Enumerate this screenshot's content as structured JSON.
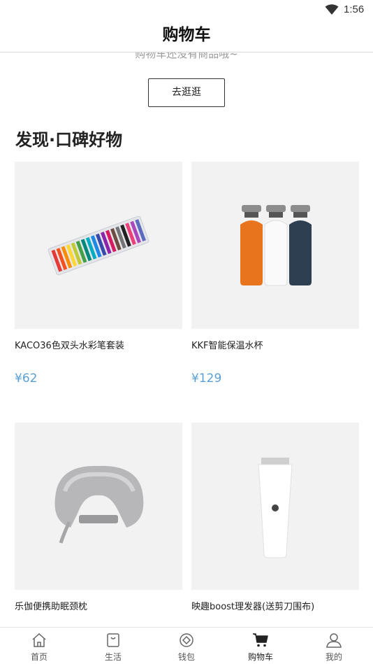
{
  "status_bar": {
    "time": "1:56"
  },
  "header": {
    "title": "购物车"
  },
  "empty_state": {
    "message": "购物车还没有商品哦~",
    "button_label": "去逛逛"
  },
  "section": {
    "title": "发现·口碑好物"
  },
  "products": [
    {
      "name": "KACO36色双头水彩笔套装",
      "price": "¥62"
    },
    {
      "name": "KKF智能保温水杯",
      "price": "¥129"
    },
    {
      "name": "乐伽便携助眠颈枕",
      "price": ""
    },
    {
      "name": "映趣boost理发器(送剪刀围布)",
      "price": ""
    }
  ],
  "tabbar": {
    "items": [
      {
        "label": "首页",
        "icon": "home-icon"
      },
      {
        "label": "生活",
        "icon": "bag-icon"
      },
      {
        "label": "钱包",
        "icon": "wallet-icon"
      },
      {
        "label": "购物车",
        "icon": "cart-icon",
        "active": true
      },
      {
        "label": "我的",
        "icon": "profile-icon"
      }
    ]
  },
  "colors": {
    "price": "#5aa0d6",
    "card_bg": "#f2f2f2",
    "orange_bottle": "#e8741e",
    "navy_bottle": "#2f3f52"
  }
}
